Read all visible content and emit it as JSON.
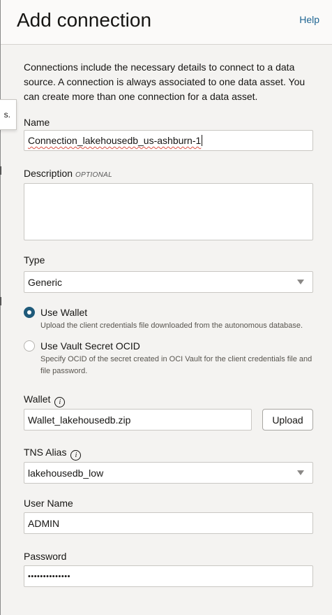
{
  "header": {
    "title": "Add connection",
    "help_label": "Help"
  },
  "tooltip_fragment": "s.",
  "intro": "Connections include the necessary details to connect to a data source. A connection is always associated to one data asset. You can create more than one connection for a data asset.",
  "form": {
    "name": {
      "label": "Name",
      "value": "Connection_lakehousedb_us-ashburn-1"
    },
    "description": {
      "label": "Description",
      "optional": "OPTIONAL",
      "value": ""
    },
    "type": {
      "label": "Type",
      "value": "Generic"
    },
    "credentials": {
      "use_wallet": {
        "label": "Use Wallet",
        "help": "Upload the client credentials file downloaded from the autonomous database.",
        "selected": true
      },
      "use_vault": {
        "label": "Use Vault Secret OCID",
        "help": "Specify OCID of the secret created in OCI Vault for the client credentials file and file password.",
        "selected": false
      }
    },
    "wallet": {
      "label": "Wallet",
      "value": "Wallet_lakehousedb.zip",
      "upload_label": "Upload"
    },
    "tns_alias": {
      "label": "TNS Alias",
      "value": "lakehousedb_low"
    },
    "user_name": {
      "label": "User Name",
      "value": "ADMIN"
    },
    "password": {
      "label": "Password",
      "value": "••••••••••••••"
    }
  },
  "colors": {
    "accent": "#1f5a7a",
    "link": "#1f6593",
    "background": "#f4f3f1"
  }
}
